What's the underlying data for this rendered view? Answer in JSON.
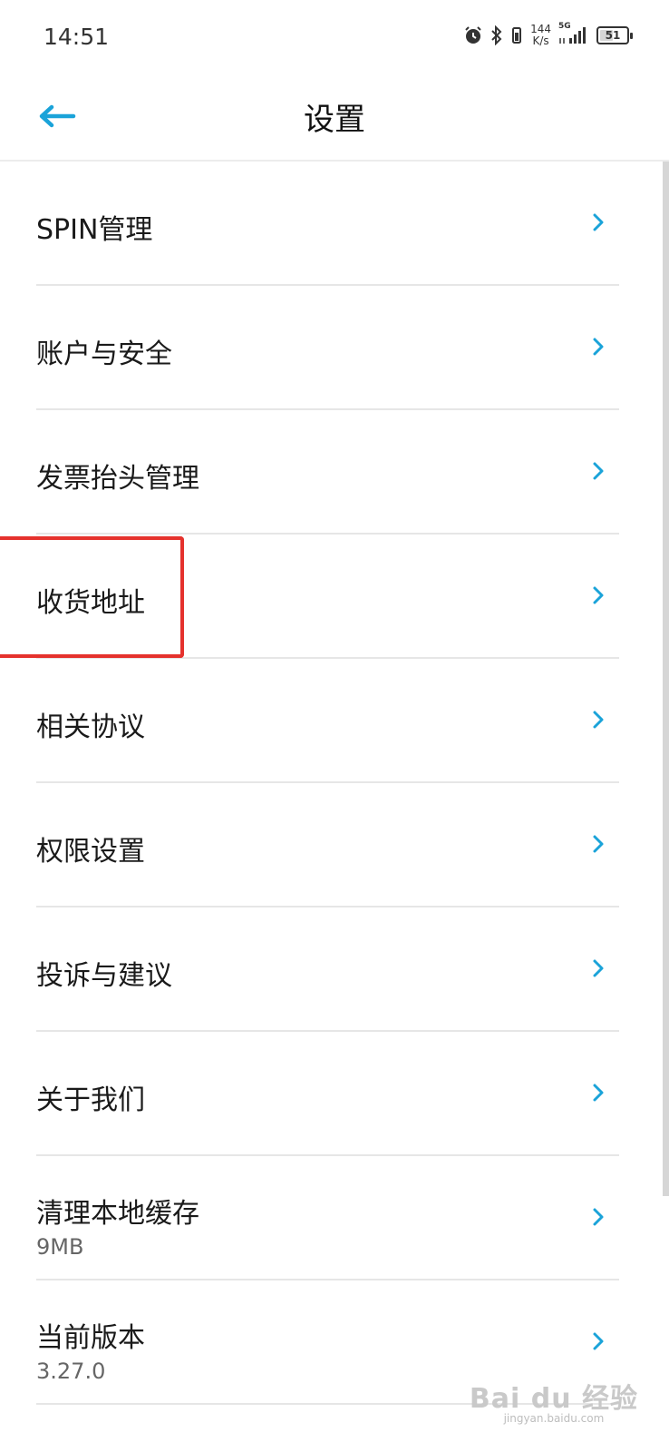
{
  "status_bar": {
    "time": "14:51",
    "net_speed_value": "144",
    "net_speed_unit": "K/s",
    "network_type": "5G",
    "battery": "51",
    "battery_level": 0.51
  },
  "header": {
    "title": "设置",
    "back_icon": "arrow-left-icon"
  },
  "settings": {
    "items": [
      {
        "label": "SPIN管理"
      },
      {
        "label": "账户与安全"
      },
      {
        "label": "发票抬头管理"
      },
      {
        "label": "收货地址"
      },
      {
        "label": "相关协议"
      },
      {
        "label": "权限设置"
      },
      {
        "label": "投诉与建议"
      },
      {
        "label": "关于我们"
      },
      {
        "label": "清理本地缓存",
        "sub": "9MB"
      },
      {
        "label": "当前版本",
        "sub": "3.27.0"
      }
    ]
  },
  "watermark": {
    "main": "Bai du 经验",
    "sub": "jingyan.baidu.com"
  },
  "colors": {
    "accent": "#1aa3d9",
    "highlight": "#e5322d"
  }
}
